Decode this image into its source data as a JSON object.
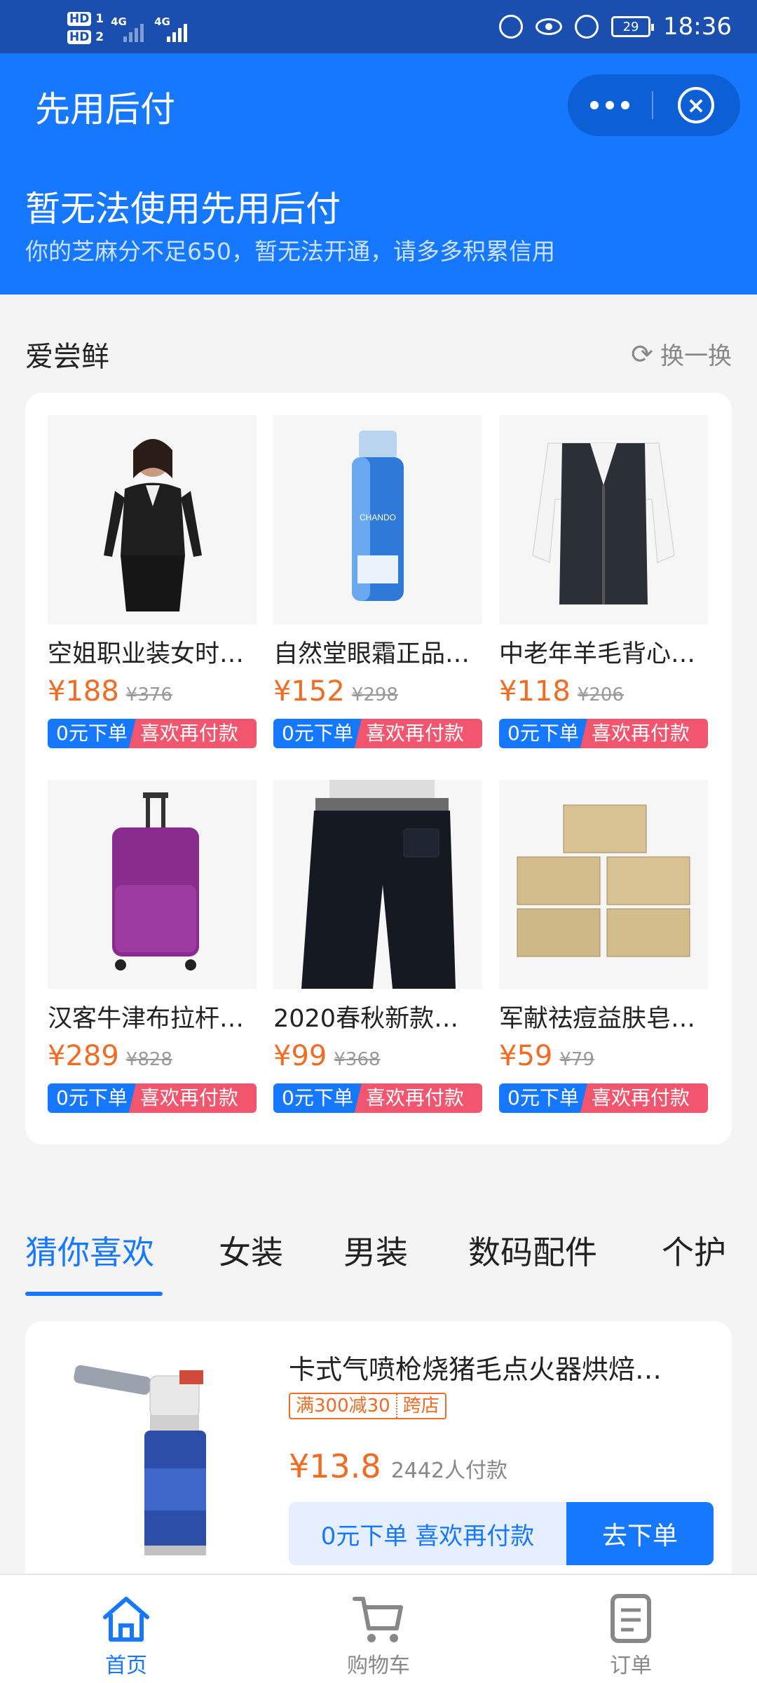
{
  "status_bar": {
    "sim1": "HD",
    "sim2": "HD",
    "net1": "4G",
    "net2": "4G",
    "battery": "29",
    "time": "18:36"
  },
  "header": {
    "title": "先用后付",
    "headline": "暂无法使用先用后付",
    "subtitle": "你的芝麻分不足650，暂无法开通，请多多积累信用"
  },
  "section": {
    "title": "爱尝鲜",
    "refresh_label": "换一换"
  },
  "tag_left": "0元下单",
  "tag_right": "喜欢再付款",
  "products": [
    {
      "name": "空姐职业装女时…",
      "price": "¥188",
      "original_price": "¥376",
      "image": "woman-suit"
    },
    {
      "name": "自然堂眼霜正品…",
      "price": "¥152",
      "original_price": "¥298",
      "image": "eye-cream"
    },
    {
      "name": "中老年羊毛背心…",
      "price": "¥118",
      "original_price": "¥206",
      "image": "wool-vest"
    },
    {
      "name": "汉客牛津布拉杆…",
      "price": "¥289",
      "original_price": "¥828",
      "image": "suitcase"
    },
    {
      "name": "2020春秋新款…",
      "price": "¥99",
      "original_price": "¥368",
      "image": "jeans"
    },
    {
      "name": "军献祛痘益肤皂…",
      "price": "¥59",
      "original_price": "¥79",
      "image": "soap-boxes"
    }
  ],
  "tabs": [
    "猜你喜欢",
    "女装",
    "男装",
    "数码配件",
    "个护"
  ],
  "active_tab": "猜你喜欢",
  "featured": {
    "name": "卡式气喷枪烧猪毛点火器烘焙…",
    "promo": "满300减30",
    "promo_type": "跨店",
    "price": "¥13.8",
    "sold": "2442人付款",
    "btn_pay_later": "0元下单 喜欢再付款",
    "btn_order": "去下单"
  },
  "bottom_nav": [
    {
      "label": "首页",
      "icon": "home-icon",
      "active": true
    },
    {
      "label": "购物车",
      "icon": "cart-icon",
      "active": false
    },
    {
      "label": "订单",
      "icon": "order-icon",
      "active": false
    }
  ],
  "colors": {
    "primary": "#1677ff",
    "price": "#f26b22",
    "tag_pink": "#f2566e",
    "status_bar": "#1a4fb0"
  }
}
